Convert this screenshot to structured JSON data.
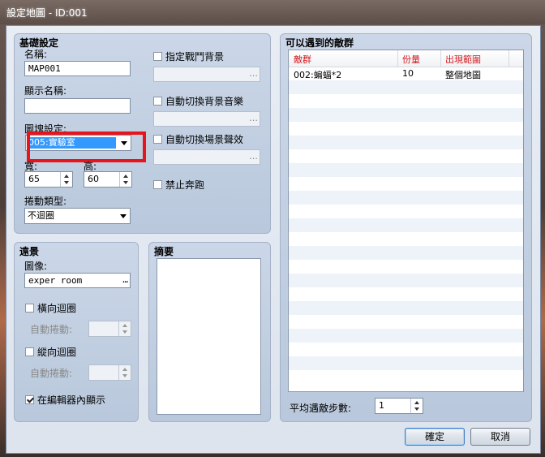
{
  "window": {
    "title": "設定地圖 - ID:001"
  },
  "basic": {
    "group_title": "基礎設定",
    "name_label": "名稱:",
    "name_value": "MAP001",
    "display_name_label": "顯示名稱:",
    "display_name_value": "",
    "tileset_label": "圖塊設定:",
    "tileset_value": "005:實驗室",
    "width_label": "寬:",
    "width_value": "65",
    "height_label": "高:",
    "height_value": "60",
    "scroll_label": "捲動類型:",
    "scroll_value": "不迴圈",
    "battleback_label": "指定戰鬥背景",
    "autoplay_bgm_label": "自動切換背景音樂",
    "autoplay_bgs_label": "自動切換場景聲效",
    "disable_dash_label": "禁止奔跑"
  },
  "parallax": {
    "group_title": "遠景",
    "image_label": "圖像:",
    "image_value": "exper room",
    "loop_h_label": "橫向迴圈",
    "auto_scroll_label": "自動捲動:",
    "loop_v_label": "縱向迴圈",
    "show_in_editor_label": "在編輯器內顯示"
  },
  "note": {
    "group_title": "摘要"
  },
  "encounters": {
    "group_title": "可以遇到的敵群",
    "columns": [
      "敵群",
      "份量",
      "出現範圍"
    ],
    "rows": [
      {
        "troop": "002:蝙蝠*2",
        "weight": "10",
        "range": "整個地圖"
      }
    ],
    "steps_label": "平均遇敵步數:",
    "steps_value": "1"
  },
  "buttons": {
    "ok": "確定",
    "cancel": "取消"
  },
  "icons": {
    "ellipsis": "…"
  }
}
